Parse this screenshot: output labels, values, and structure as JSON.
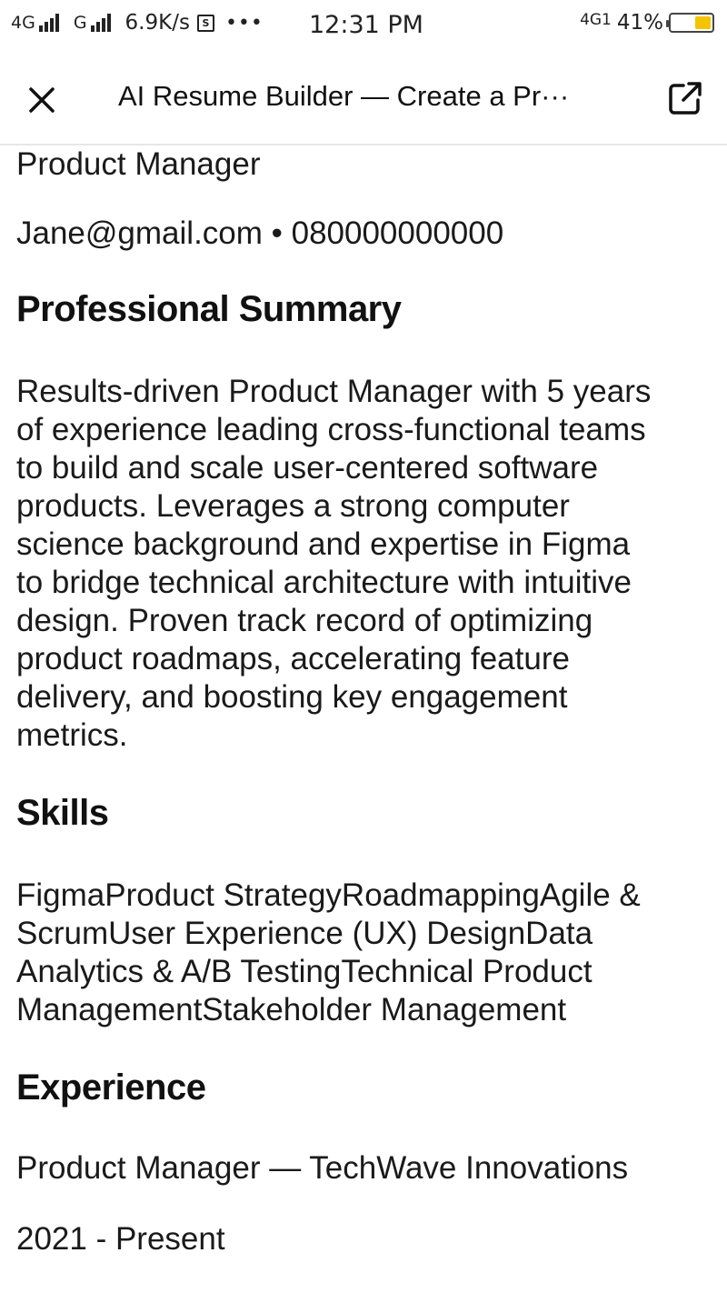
{
  "status_bar": {
    "net1_label": "4G",
    "net2_label": "G",
    "speed": "6.9K/s",
    "s_icon_label": "S",
    "more": "•••",
    "time": "12:31 PM",
    "net_right": "4G1",
    "battery_percent": "41%",
    "battery_level": 0.41,
    "battery_color": "#f5c400"
  },
  "app_bar": {
    "title": "AI Resume Builder — Create a Pr···",
    "close_icon": "close-icon",
    "open_external_icon": "open-external-icon"
  },
  "resume": {
    "role": "Product Manager",
    "contact": "Jane@gmail.com • 080000000000",
    "summary_heading": "Professional Summary",
    "summary_lines": [
      "Results-driven Product Manager with 5 years",
      "of experience leading cross-functional teams",
      "to build and scale user-centered software",
      "products. Leverages a strong computer",
      "science background and expertise in Figma",
      "to bridge technical architecture with intuitive",
      "design. Proven track record of optimizing",
      "product roadmaps, accelerating feature",
      "delivery, and boosting key engagement",
      "metrics."
    ],
    "skills_heading": "Skills",
    "skills_lines": [
      "FigmaProduct StrategyRoadmappingAgile &",
      "ScrumUser Experience (UX) DesignData",
      "Analytics & A/B TestingTechnical Product",
      "ManagementStakeholder Management"
    ],
    "experience_heading": "Experience",
    "job_title": "Product Manager — TechWave Innovations",
    "job_dates": "2021 - Present"
  }
}
